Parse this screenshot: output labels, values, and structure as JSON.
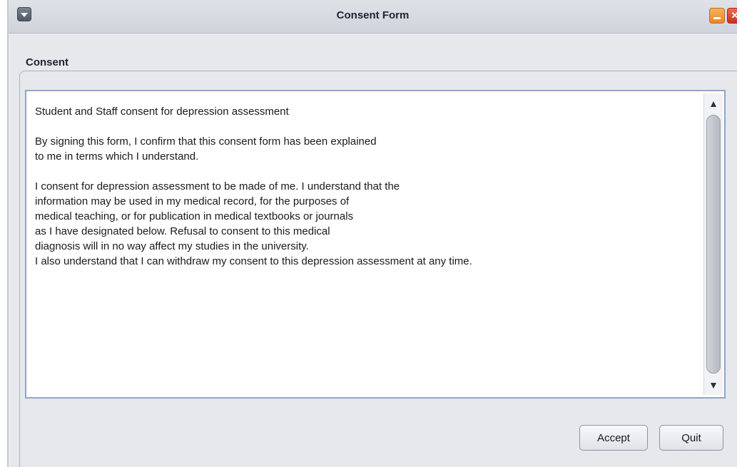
{
  "window": {
    "title": "Consent Form",
    "close_glyph": "✕"
  },
  "section": {
    "label": "Consent"
  },
  "consent_text": {
    "lines": [
      "Student and Staff consent for depression assessment",
      "",
      "By signing this form, I confirm that this consent form has been explained",
      "to me in terms which I understand.",
      "",
      "I consent for depression assessment to be made of me. I understand that the",
      "information may be used in my medical record, for the purposes of",
      "medical teaching, or for publication in medical textbooks or journals",
      "as I have designated below. Refusal to consent to this medical",
      "diagnosis will in no way affect my studies in the university.",
      "I also understand that I can withdraw my consent to this depression assessment at any time."
    ]
  },
  "buttons": {
    "accept_label": "Accept",
    "quit_label": "Quit"
  },
  "icons": {
    "window_menu": "window-menu-icon",
    "minimize": "minimize-icon",
    "close": "close-icon",
    "scroll_up": "scroll-up-arrow-icon",
    "scroll_down": "scroll-down-arrow-icon"
  },
  "colors": {
    "minimize_button": "#e8862a",
    "close_button": "#c9321f",
    "text_area_border": "#8fa6c7"
  }
}
